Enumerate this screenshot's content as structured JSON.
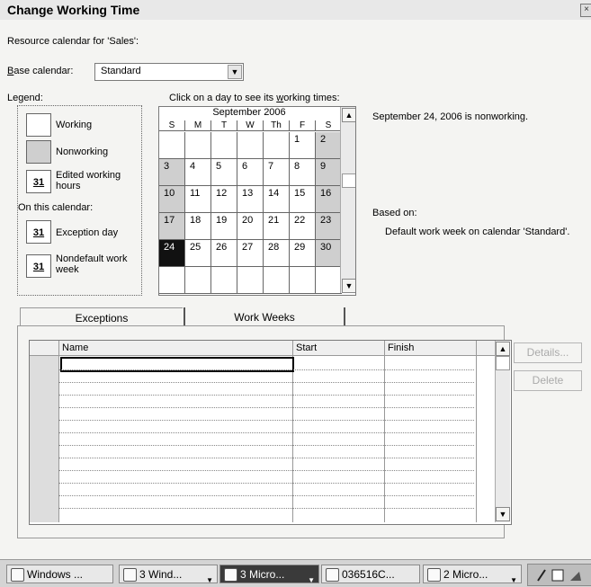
{
  "window": {
    "title": "Change Working Time",
    "close": "×"
  },
  "resource_label": "Resource calendar for 'Sales':",
  "base_calendar": {
    "label_prefix": "B",
    "label_rest": "ase calendar:",
    "value": "Standard",
    "arrow": "▼"
  },
  "legend": {
    "title": "Legend:",
    "working": "Working",
    "nonworking": "Nonworking",
    "edited_line1": "Edited working",
    "edited_line2": "hours",
    "on_this_calendar": "On this calendar:",
    "exception_day": "Exception day",
    "nondefault_line1": "Nondefault work",
    "nondefault_line2": "week",
    "number": "31"
  },
  "calendar": {
    "instruction_pre": "Click on a day to see its ",
    "instruction_u": "w",
    "instruction_post": "orking times:",
    "month": "September 2006",
    "days": [
      "S",
      "M",
      "T",
      "W",
      "Th",
      "F",
      "S"
    ],
    "weeks": [
      [
        "",
        "",
        "",
        "",
        "",
        "1",
        "2"
      ],
      [
        "3",
        "4",
        "5",
        "6",
        "7",
        "8",
        "9"
      ],
      [
        "10",
        "11",
        "12",
        "13",
        "14",
        "15",
        "16"
      ],
      [
        "17",
        "18",
        "19",
        "20",
        "21",
        "22",
        "23"
      ],
      [
        "24",
        "25",
        "26",
        "27",
        "28",
        "29",
        "30"
      ],
      [
        "",
        "",
        "",
        "",
        "",
        "",
        ""
      ]
    ],
    "selected": "24",
    "up": "▲",
    "down": "▼"
  },
  "info": {
    "status": "September 24, 2006 is nonworking.",
    "based_on": "Based on:",
    "based_detail": "Default work week on calendar 'Standard'."
  },
  "tabs": {
    "exceptions": "Exceptions",
    "work_weeks": "Work Weeks"
  },
  "table": {
    "headers": {
      "name": "Name",
      "start": "Start",
      "finish": "Finish"
    },
    "up": "▲",
    "down": "▼"
  },
  "buttons": {
    "details": "Details...",
    "delete": "Delete"
  },
  "taskbar": {
    "items": [
      "Windows ...",
      "3 Wind...",
      "3 Micro...",
      "036516C...",
      "2 Micro..."
    ],
    "caret": "▼"
  }
}
